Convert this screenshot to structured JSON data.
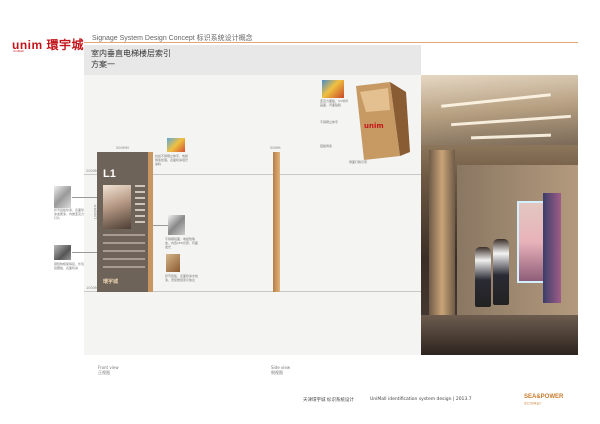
{
  "brand": {
    "logo_text": "unim 環宇城",
    "logo_sub": "UniMall"
  },
  "header": {
    "title": "Signage System Design Concept  标识系统设计概念",
    "section_title": "室内垂直电梯楼层索引",
    "subtitle": "方案一"
  },
  "drawing": {
    "dims": {
      "top_mark": "2000MM",
      "bottom_mark": "1000MM",
      "width_mark": "500MM",
      "side_mark": "50MM",
      "height_mark": "1000MM"
    },
    "front_sign": {
      "floor_label": "L1",
      "brand_mark": "環宇城"
    },
    "callouts": [
      {
        "name": "callout-top-center",
        "text": "拉丝不锈钢立体字，电镀烤漆处理，表面喷涂哑光涂料"
      },
      {
        "name": "callout-left-upper",
        "text": "折弯铝板喷漆，表面喷涂金属漆，内嵌亚克力灯片"
      },
      {
        "name": "callout-left-lower",
        "text": "钢结构框架焊接，外包铝塑板，表面喷涂"
      },
      {
        "name": "callout-center",
        "text": "不锈钢镜面，电镀玫瑰金，内置LED光源，背面发光"
      },
      {
        "name": "callout-center-lower",
        "text": "折弯铝板，表面喷涂木纹漆，安装楼层索引信息"
      },
      {
        "name": "callout-right-1",
        "text": "亚克力面板，UV喷印画面，背面贴膜"
      },
      {
        "name": "callout-right-2",
        "text": "不锈钢立体字"
      },
      {
        "name": "callout-right-3",
        "text": "铝板烤漆"
      },
      {
        "name": "callout-right-bottom",
        "text": "侧面灯箱示意"
      }
    ],
    "views": {
      "front_en": "Front view",
      "front_cn": "正视图",
      "side_en": "Side view",
      "side_cn": "侧视图"
    }
  },
  "footer": {
    "project_cn": "天津環宇城  标识系统设计",
    "project_en": "UniMall identification system design | 2013.7",
    "designer": "SEA&POWER",
    "designer_sub": "海之力形象设计"
  },
  "colors": {
    "brand_red": "#c4161c",
    "accent_copper": "#c99560",
    "rule_orange": "#e5a874"
  }
}
